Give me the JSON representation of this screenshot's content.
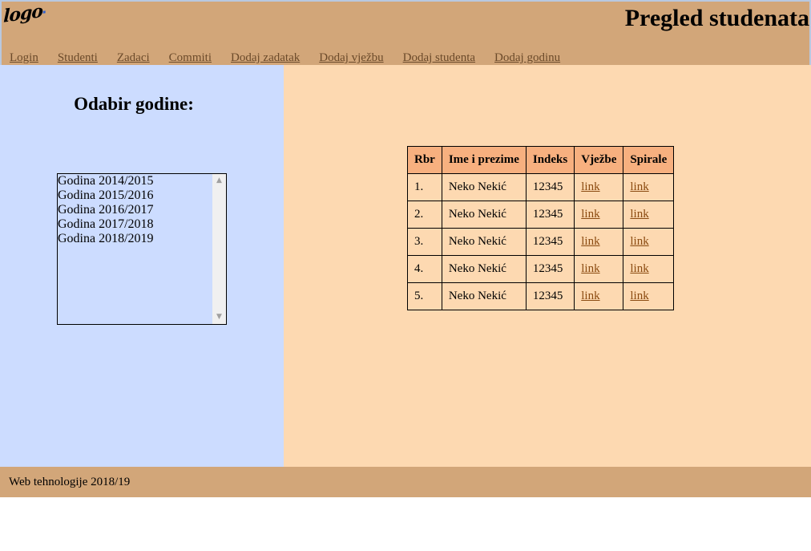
{
  "header": {
    "logo_text": "logo",
    "title": "Pregled studenata"
  },
  "nav": {
    "items": [
      {
        "label": "Login"
      },
      {
        "label": "Studenti"
      },
      {
        "label": "Zadaci"
      },
      {
        "label": "Commiti"
      },
      {
        "label": "Dodaj zadatak"
      },
      {
        "label": "Dodaj vježbu"
      },
      {
        "label": "Dodaj studenta"
      },
      {
        "label": "Dodaj godinu"
      }
    ]
  },
  "sidebar": {
    "heading": "Odabir godine:",
    "years": [
      "Godina 2014/2015",
      "Godina 2015/2016",
      "Godina 2016/2017",
      "Godina 2017/2018",
      "Godina 2018/2019"
    ]
  },
  "table": {
    "headers": [
      "Rbr",
      "Ime i prezime",
      "Indeks",
      "Vježbe",
      "Spirale"
    ],
    "rows": [
      {
        "rbr": "1.",
        "name": "Neko Nekić",
        "index": "12345",
        "vjezbe": "link",
        "spirale": "link"
      },
      {
        "rbr": "2.",
        "name": "Neko Nekić",
        "index": "12345",
        "vjezbe": "link",
        "spirale": "link"
      },
      {
        "rbr": "3.",
        "name": "Neko Nekić",
        "index": "12345",
        "vjezbe": "link",
        "spirale": "link"
      },
      {
        "rbr": "4.",
        "name": "Neko Nekić",
        "index": "12345",
        "vjezbe": "link",
        "spirale": "link"
      },
      {
        "rbr": "5.",
        "name": "Neko Nekić",
        "index": "12345",
        "vjezbe": "link",
        "spirale": "link"
      }
    ]
  },
  "footer": {
    "text": "Web tehnologije 2018/19"
  },
  "colors": {
    "header_bg": "#d2a679",
    "sidebar_bg": "#ccdcff",
    "content_bg": "#fdd9b1",
    "table_header_bg": "#f7b07f"
  }
}
